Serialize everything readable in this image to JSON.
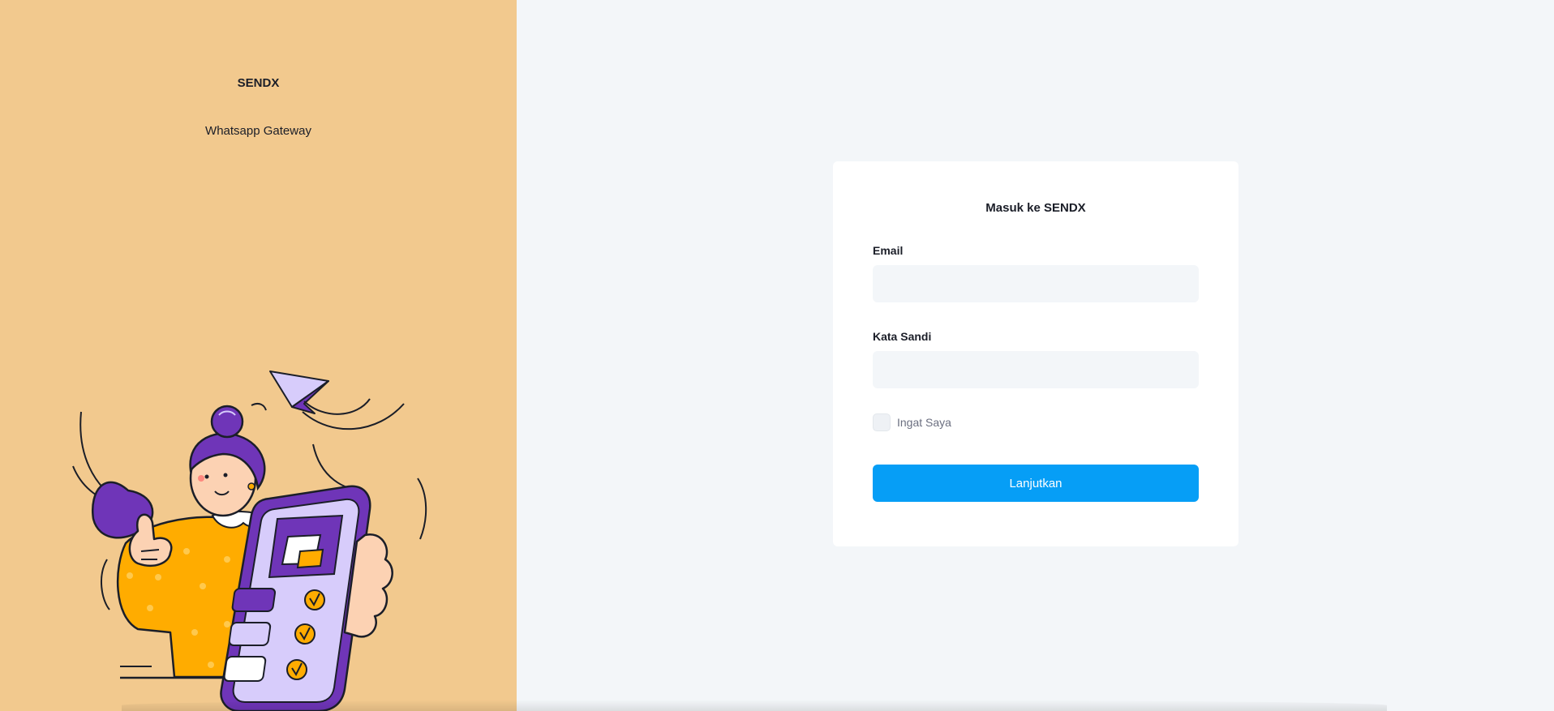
{
  "brand": {
    "name": "SENDX",
    "tagline": "Whatsapp Gateway"
  },
  "login": {
    "title": "Masuk ke SENDX",
    "email_label": "Email",
    "email_value": "",
    "password_label": "Kata Sandi",
    "password_value": "",
    "remember_label": "Ingat Saya",
    "remember_checked": false,
    "submit_label": "Lanjutkan"
  },
  "colors": {
    "left_panel_bg": "#f2c98e",
    "page_bg": "#f3f6f9",
    "card_bg": "#ffffff",
    "primary": "#069ef6",
    "illustration_purple": "#6f35b8",
    "illustration_yellow": "#ffac00",
    "illustration_lavender": "#d7ccfb"
  },
  "illustration": {
    "icon": "woman-with-phone-illustration"
  }
}
